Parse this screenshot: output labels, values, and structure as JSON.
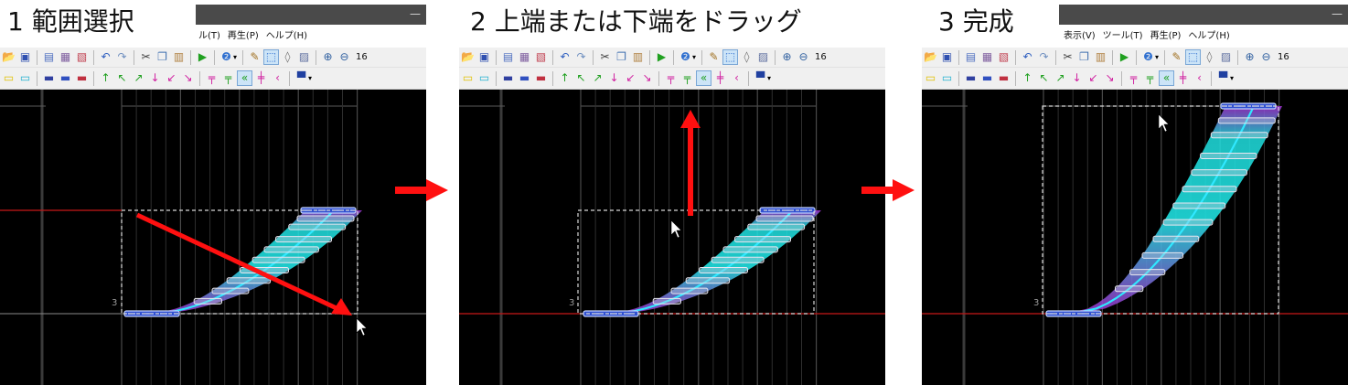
{
  "steps": [
    {
      "title": "1  範囲選択"
    },
    {
      "title": "2  上端または下端をドラッグ"
    },
    {
      "title": "3  完成"
    }
  ],
  "menus": {
    "panel1": [
      "ル(T)",
      "再生(P)",
      "ヘルプ(H)"
    ],
    "panel3": [
      "表示(V)",
      "ツール(T)",
      "再生(P)",
      "ヘルプ(H)"
    ]
  },
  "toolbar": {
    "zoom_label": "16"
  },
  "canvas": {
    "lane_number": "3"
  },
  "colors": {
    "note_start": "#a030d0",
    "note_end": "#20e0e0",
    "center_line": "#30e8ff",
    "selection": "#d8d8d8",
    "arrow": "#ff1010",
    "baseline_red": "#c81818"
  },
  "icons": {
    "toolbar1": [
      "open-folder-icon",
      "save-icon",
      "separator",
      "page-icon",
      "properties-icon",
      "export-icon",
      "separator",
      "undo-icon",
      "redo-icon",
      "separator",
      "cut-icon",
      "copy-icon",
      "paste-icon",
      "separator",
      "play-icon",
      "separator",
      "help-icon",
      "separator",
      "pencil-icon",
      "select-rect-icon",
      "eraser-icon",
      "edit-icon",
      "separator",
      "zoom-in-icon",
      "zoom-out-icon"
    ],
    "toolbar2": [
      "tap-note-icon",
      "ex-note-icon",
      "separator",
      "hold-note-icon",
      "slide-icon",
      "air-icon",
      "separator",
      "air-up-icon",
      "air-upleft-icon",
      "air-upright-icon",
      "air-down-icon",
      "air-downleft-icon",
      "air-downright-icon",
      "separator",
      "air-action-icon",
      "air-hold-icon",
      "flick-icon",
      "damage-icon",
      "bpm-icon",
      "separator",
      "event-icon"
    ]
  }
}
